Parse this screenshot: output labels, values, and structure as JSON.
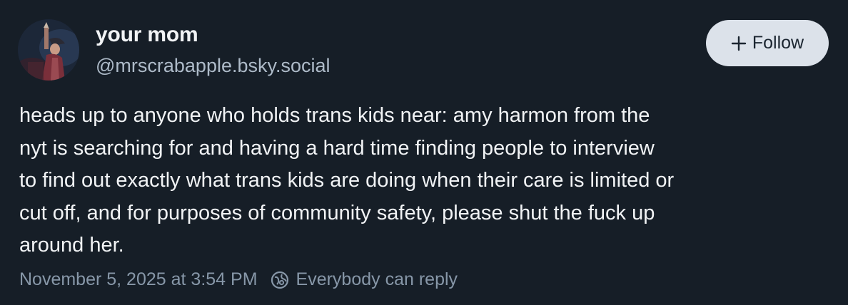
{
  "author": {
    "display_name": "your mom",
    "handle": "@mrscrabapple.bsky.social",
    "avatar_icon": "avatar-photo"
  },
  "follow_button": {
    "label": "Follow",
    "icon": "plus-icon"
  },
  "post": {
    "text": "heads up to anyone who holds trans kids near: amy harmon from the\nnyt is searching for and having a hard time finding people to interview\nto find out exactly what trans kids are doing when their care is limited or\ncut off, and for purposes of community safety, please shut the fuck up\naround her."
  },
  "meta": {
    "timestamp": "November 5, 2025 at 3:54 PM",
    "reply_setting": "Everybody can reply",
    "reply_icon": "globe-icon"
  },
  "colors": {
    "background": "#161e27",
    "text": "#f1f3f5",
    "secondary_text": "#aebbc9",
    "meta_text": "#8797a8",
    "follow_button_bg": "#dce2ea"
  }
}
